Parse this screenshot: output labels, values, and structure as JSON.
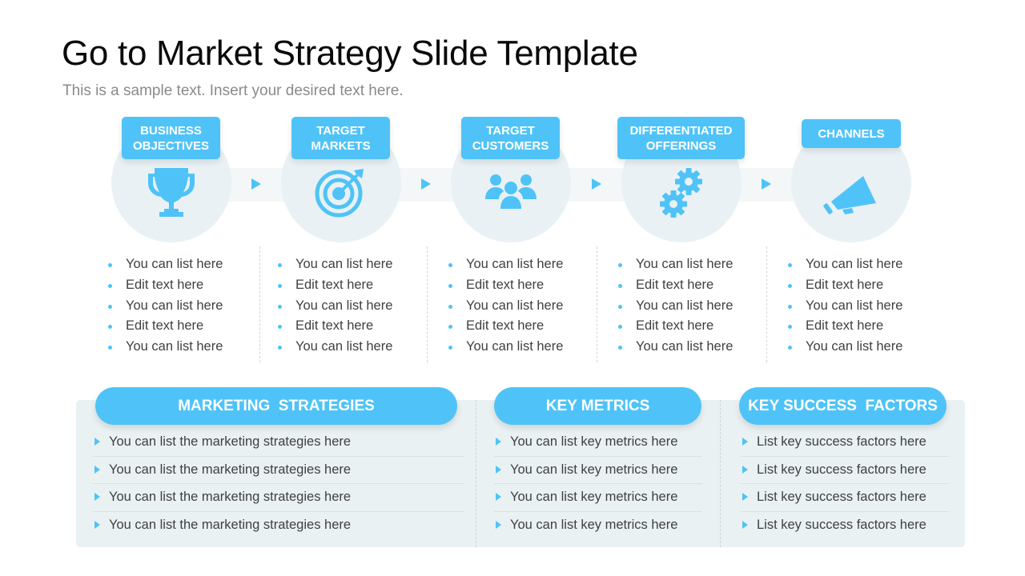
{
  "header": {
    "title": "Go to Market Strategy Slide Template",
    "subtitle": "This is a sample text. Insert your desired text here."
  },
  "colors": {
    "accent": "#4fc3f7",
    "circle_bg": "#e9f1f4",
    "panel_bg": "#eaf1f3",
    "title": "#0a0a0a",
    "subtitle": "#8a8a8a",
    "body_text": "#404040"
  },
  "steps": [
    {
      "label_line1": "BUSINESS",
      "label_line2": "OBJECTIVES",
      "icon": "trophy-icon",
      "items": [
        "You can list here",
        "Edit text here",
        "You can list here",
        "Edit text here",
        "You can list here"
      ]
    },
    {
      "label_line1": "TARGET",
      "label_line2": "MARKETS",
      "icon": "target-icon",
      "items": [
        "You can list here",
        "Edit text here",
        "You can list here",
        "Edit text here",
        "You can list here"
      ]
    },
    {
      "label_line1": "TARGET",
      "label_line2": "CUSTOMERS",
      "icon": "users-group-icon",
      "items": [
        "You can list here",
        "Edit text here",
        "You can list here",
        "Edit text here",
        "You can list here"
      ]
    },
    {
      "label_line1": "DIFFERENTIATED",
      "label_line2": "OFFERINGS",
      "icon": "gears-icon",
      "items": [
        "You can list here",
        "Edit text here",
        "You can list here",
        "Edit text here",
        "You can list here"
      ]
    },
    {
      "label_line1": "CHANNELS",
      "label_line2": "",
      "icon": "megaphone-icon",
      "items": [
        "You can list here",
        "Edit text here",
        "You can list here",
        "Edit text here",
        "You can list here"
      ]
    }
  ],
  "sections": [
    {
      "title": "MARKETING  STRATEGIES",
      "items": [
        "You can list the marketing strategies here",
        "You can list the marketing strategies here",
        "You can list the marketing strategies here",
        "You can list the marketing strategies here"
      ]
    },
    {
      "title": "KEY METRICS",
      "items": [
        "You can list key metrics here",
        "You can list key metrics here",
        "You can list key metrics here",
        "You can list key metrics here"
      ]
    },
    {
      "title": "KEY SUCCESS  FACTORS",
      "items": [
        "List key success factors here",
        "List key success factors here",
        "List key success factors here",
        "List key success factors here"
      ]
    }
  ]
}
